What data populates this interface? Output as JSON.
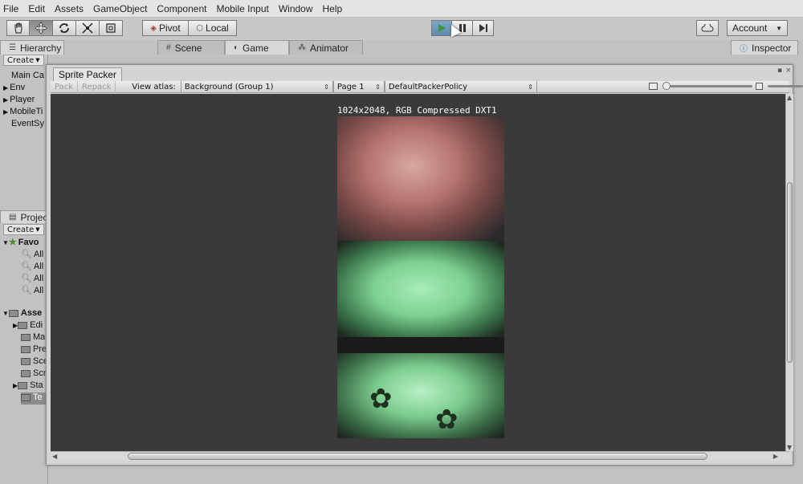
{
  "menu": [
    "File",
    "Edit",
    "Assets",
    "GameObject",
    "Component",
    "Mobile Input",
    "Window",
    "Help"
  ],
  "toolbar": {
    "pivot_label": "Pivot",
    "local_label": "Local",
    "account_label": "Account"
  },
  "tabs": {
    "hierarchy": "Hierarchy",
    "scene": "Scene",
    "game": "Game",
    "animator": "Animator",
    "inspector": "Inspector",
    "project": "Project"
  },
  "hierarchy": {
    "create_label": "Create",
    "items": [
      "Main Ca",
      "Env",
      "Player",
      "MobileTi",
      "EventSy"
    ]
  },
  "project": {
    "create_label": "Create",
    "favorites_label": "Favo",
    "favorites": [
      "All",
      "All",
      "All",
      "All"
    ],
    "assets_label": "Asse",
    "folders": [
      "Edi",
      "Ma",
      "Pre",
      "Sce",
      "Scr",
      "Sta",
      "Te"
    ]
  },
  "sprite_packer": {
    "title": "Sprite Packer",
    "pack_label": "Pack",
    "repack_label": "Repack",
    "view_atlas_label": "View atlas:",
    "atlas_value": "Background (Group 1)",
    "page_value": "Page 1",
    "policy_value": "DefaultPackerPolicy",
    "atlas_info": "1024x2048, RGB Compressed DXT1"
  },
  "colors": {
    "viewport_bg": "#3a3a3a",
    "window_bg": "#d4d4d4",
    "play_active": "#6f98bc"
  }
}
